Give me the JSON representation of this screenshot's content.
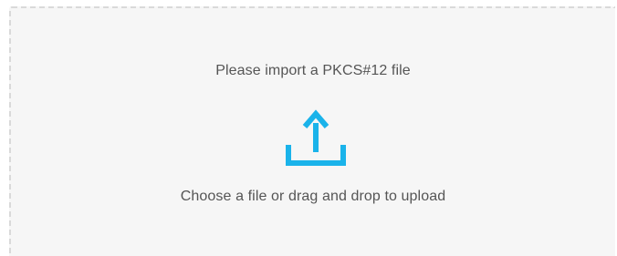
{
  "dropzone": {
    "title": "Please import a PKCS#12 file",
    "hint": "Choose a file or drag and drop to upload",
    "icon": "upload-icon",
    "accent_color": "#1ab3ea",
    "background_color": "#f6f6f6",
    "border_color": "#d9d9d9"
  }
}
